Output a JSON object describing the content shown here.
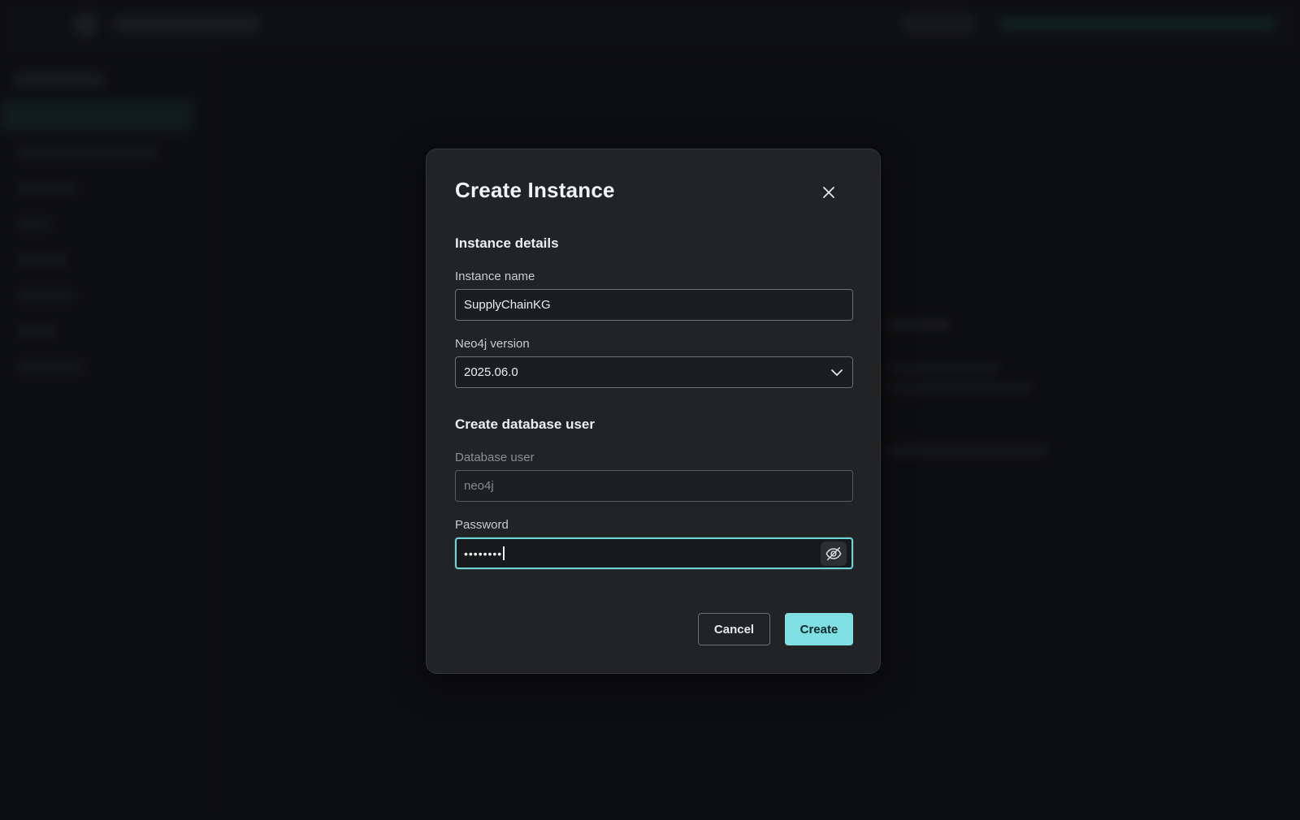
{
  "modal": {
    "title": "Create Instance",
    "close_icon": "close-icon",
    "sections": {
      "details_title": "Instance details",
      "user_title": "Create database user"
    },
    "fields": {
      "instance_name": {
        "label": "Instance name",
        "value": "SupplyChainKG"
      },
      "neo4j_version": {
        "label": "Neo4j version",
        "value": "2025.06.0",
        "icon": "chevron-down-icon"
      },
      "database_user": {
        "label": "Database user",
        "value": "neo4j",
        "disabled": true
      },
      "password": {
        "label": "Password",
        "masked_value": "••••••••",
        "toggle_icon": "eye-off-icon",
        "focused": true
      }
    },
    "buttons": {
      "cancel": "Cancel",
      "create": "Create"
    }
  },
  "colors": {
    "accent": "#7fdfe3",
    "focus_border": "#6fd4d8",
    "modal_bg": "#212325",
    "page_bg": "#121314"
  }
}
